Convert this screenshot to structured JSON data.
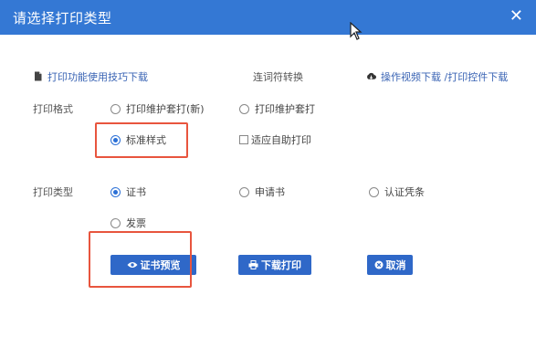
{
  "dialog": {
    "title": "请选择打印类型",
    "close_glyph": "✕"
  },
  "links": {
    "tips": "打印功能使用技巧下载",
    "converter": "连词符转换",
    "video": "操作视频下载 /打印控件下载"
  },
  "print_style": {
    "label": "打印格式",
    "options": [
      {
        "label": "打印维护套打(新)",
        "checked": false
      },
      {
        "label": "打印维护套打",
        "checked": false
      },
      {
        "label": "标准样式",
        "checked": true
      }
    ],
    "auto_print_label": "适应自助打印"
  },
  "print_type": {
    "label": "打印类型",
    "options": [
      {
        "label": "证书",
        "checked": true
      },
      {
        "label": "申请书",
        "checked": false
      },
      {
        "label": "认证凭条",
        "checked": false
      },
      {
        "label": "发票",
        "checked": false
      }
    ]
  },
  "buttons": {
    "preview": "证书预览",
    "download": "下载打印",
    "cancel": "取消"
  },
  "colors": {
    "titlebar": "#3478d4",
    "button": "#2f68c8",
    "highlight": "#e8553e"
  }
}
